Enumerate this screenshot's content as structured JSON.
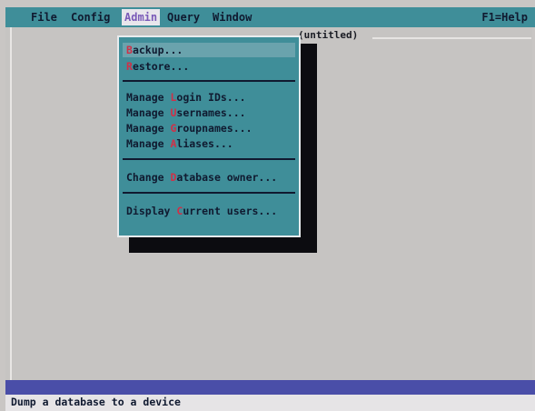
{
  "menubar": {
    "items": [
      {
        "label": "File"
      },
      {
        "label": "Config"
      },
      {
        "label": "Admin",
        "active": true
      },
      {
        "label": "Query"
      },
      {
        "label": "Window"
      }
    ],
    "help": "F1=Help"
  },
  "window": {
    "title": "(untitled)"
  },
  "admin_menu": {
    "items": [
      {
        "hotkey": "B",
        "rest": "ackup..."
      },
      {
        "hotkey": "R",
        "rest": "estore..."
      },
      {
        "prefix": "Manage ",
        "hotkey": "L",
        "rest": "ogin IDs..."
      },
      {
        "prefix": "Manage ",
        "hotkey": "U",
        "rest": "sernames..."
      },
      {
        "prefix": "Manage ",
        "hotkey": "G",
        "rest": "roupnames..."
      },
      {
        "prefix": "Manage ",
        "hotkey": "A",
        "rest": "liases..."
      },
      {
        "prefix": "Change ",
        "hotkey": "D",
        "rest": "atabase owner..."
      },
      {
        "prefix": "Display ",
        "hotkey": "C",
        "rest": "urrent users..."
      }
    ]
  },
  "status": {
    "text": "Dump a database to a device"
  },
  "colors": {
    "menubar": "#3f8e99",
    "hotkey": "#d03048",
    "highlight": "#6aa3ad",
    "scrollbar": "#4a4ea8"
  }
}
